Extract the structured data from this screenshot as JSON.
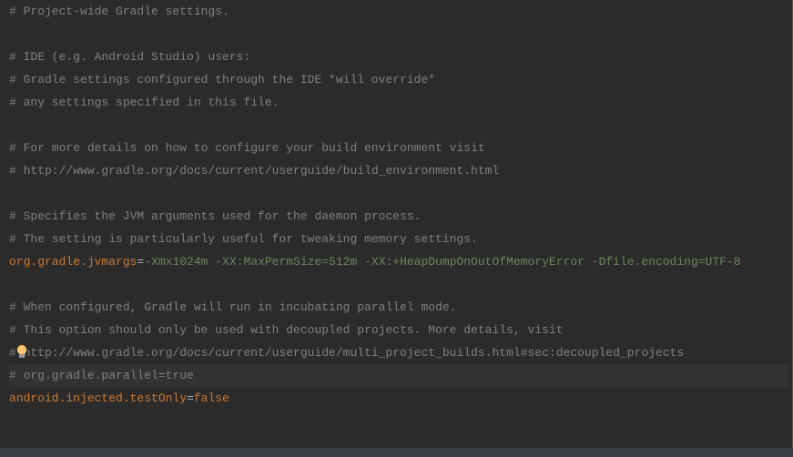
{
  "lines": [
    {
      "type": "comment",
      "text": "# Project-wide Gradle settings."
    },
    {
      "type": "blank",
      "text": ""
    },
    {
      "type": "comment",
      "text": "# IDE (e.g. Android Studio) users:"
    },
    {
      "type": "comment",
      "text": "# Gradle settings configured through the IDE *will override*"
    },
    {
      "type": "comment",
      "text": "# any settings specified in this file."
    },
    {
      "type": "blank",
      "text": ""
    },
    {
      "type": "comment",
      "text": "# For more details on how to configure your build environment visit"
    },
    {
      "type": "comment",
      "text": "# http://www.gradle.org/docs/current/userguide/build_environment.html"
    },
    {
      "type": "blank",
      "text": ""
    },
    {
      "type": "comment",
      "text": "# Specifies the JVM arguments used for the daemon process."
    },
    {
      "type": "comment",
      "text": "# The setting is particularly useful for tweaking memory settings."
    },
    {
      "type": "property-green",
      "key": "org.gradle.jvmargs",
      "value": "-Xmx1024m -XX:MaxPermSize=512m -XX:+HeapDumpOnOutOfMemoryError -Dfile.encoding=UTF-8"
    },
    {
      "type": "blank",
      "text": ""
    },
    {
      "type": "comment",
      "text": "# When configured, Gradle will run in incubating parallel mode."
    },
    {
      "type": "comment",
      "text": "# This option should only be used with decoupled projects. More details, visit"
    },
    {
      "type": "comment-bulb",
      "text": "# http://www.gradle.org/docs/current/userguide/multi_project_builds.html#sec:decoupled_projects"
    },
    {
      "type": "comment-highlighted",
      "text": "# org.gradle.parallel=true"
    },
    {
      "type": "property-orange",
      "key": "android.injected.testOnly",
      "value": "false"
    }
  ]
}
